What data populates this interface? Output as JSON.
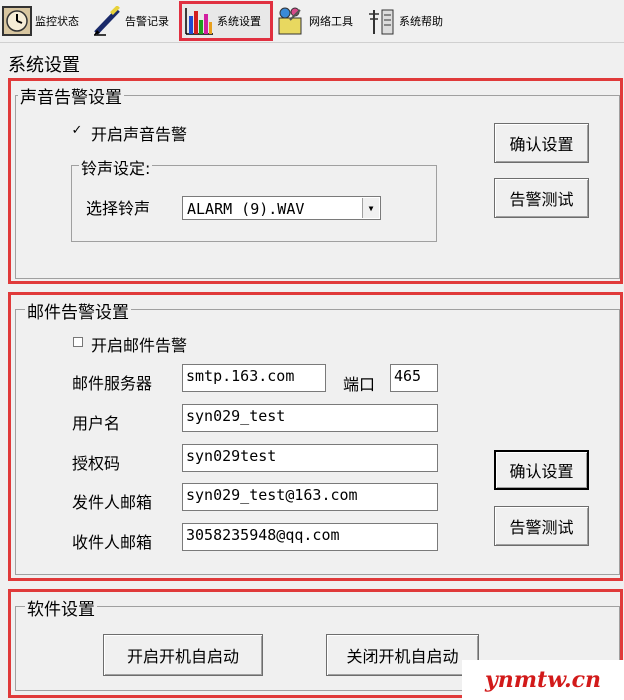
{
  "toolbar": {
    "items": [
      {
        "label": "监控状态",
        "icon": "clock-monitor-icon"
      },
      {
        "label": "告警记录",
        "icon": "pen-record-icon"
      },
      {
        "label": "系统设置",
        "icon": "bar-chart-icon"
      },
      {
        "label": "网络工具",
        "icon": "network-tools-icon"
      },
      {
        "label": "系统帮助",
        "icon": "help-antenna-icon"
      }
    ],
    "active": "系统设置"
  },
  "page": {
    "title": "系统设置"
  },
  "sound": {
    "title": "声音告警设置",
    "enable_label": "开启声音告警",
    "enable_checked": true,
    "check_mark": "✓",
    "ringtone_group": "铃声设定:",
    "select_label": "选择铃声",
    "selected_ringtone": "ALARM (9).WAV",
    "confirm_button": "确认设置",
    "test_button": "告警测试"
  },
  "mail": {
    "title": "邮件告警设置",
    "enable_label": "开启邮件告警",
    "enable_checked": false,
    "server_label": "邮件服务器",
    "server_value": "smtp.163.com",
    "port_label": "端口",
    "port_value": "465",
    "username_label": "用户名",
    "username_value": "syn029_test",
    "authcode_label": "授权码",
    "authcode_value": "syn029test",
    "sender_label": "发件人邮箱",
    "sender_value": "syn029_test@163.com",
    "recipient_label": "收件人邮箱",
    "recipient_value": "3058235948@qq.com",
    "confirm_button": "确认设置",
    "test_button": "告警测试"
  },
  "software": {
    "title": "软件设置",
    "autostart_on": "开启开机自启动",
    "autostart_off": "关闭开机自启动"
  },
  "watermark": "ynmtw.cn",
  "colors": {
    "highlight": "#e03a3a",
    "watermark": "#d21a1a",
    "window_bg": "#f0f0f0"
  }
}
